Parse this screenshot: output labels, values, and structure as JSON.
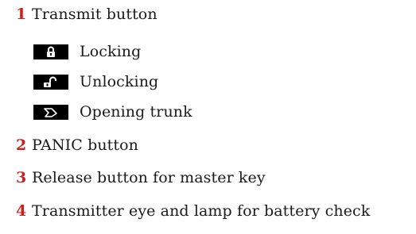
{
  "accent_color": "#cc1f1f",
  "items": [
    {
      "number": "1",
      "label": "Transmit button"
    },
    {
      "icon": "lock-closed-icon",
      "label": "Locking"
    },
    {
      "icon": "lock-open-icon",
      "label": "Unlocking"
    },
    {
      "icon": "trunk-open-icon",
      "label": "Opening trunk"
    },
    {
      "number": "2",
      "label": "PANIC button"
    },
    {
      "number": "3",
      "label": "Release button for master key"
    },
    {
      "number": "4",
      "label": "Transmitter eye and lamp for battery check"
    }
  ]
}
